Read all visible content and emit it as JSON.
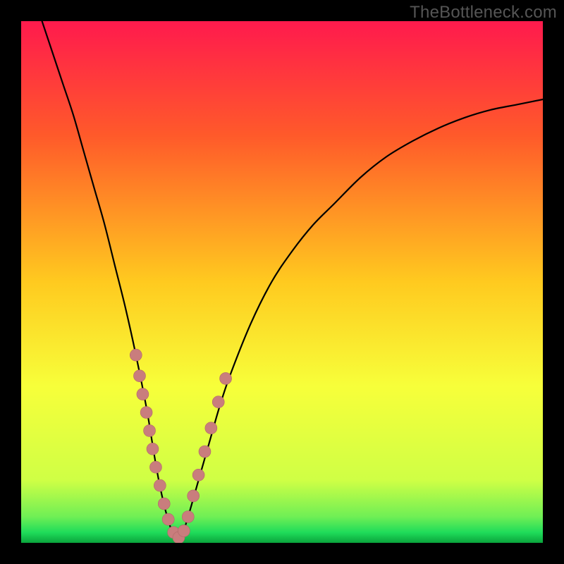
{
  "watermark": "TheBottleneck.com",
  "colors": {
    "frame": "#000000",
    "watermark": "#555555",
    "curve": "#000000",
    "marker_fill": "#c97d7d",
    "marker_stroke": "#b06868",
    "gradient_top": "#ff1a4d",
    "gradient_mid1": "#ff6a2a",
    "gradient_mid2": "#ffd21f",
    "gradient_mid3": "#f7ff3a",
    "gradient_low": "#d8ff4a",
    "gradient_green": "#1fdc5a",
    "gradient_base": "#0aa43c"
  },
  "chart_data": {
    "type": "line",
    "title": "",
    "xlabel": "",
    "ylabel": "",
    "xlim": [
      0,
      100
    ],
    "ylim": [
      0,
      100
    ],
    "series": [
      {
        "name": "bottleneck-curve",
        "x": [
          4,
          6,
          8,
          10,
          12,
          14,
          16,
          18,
          20,
          22,
          24,
          25,
          26,
          27,
          28,
          29,
          30,
          31,
          32,
          34,
          36,
          38,
          40,
          44,
          48,
          52,
          56,
          60,
          65,
          70,
          75,
          80,
          85,
          90,
          95,
          100
        ],
        "y": [
          100,
          94,
          88,
          82,
          75,
          68,
          61,
          53,
          45,
          36,
          26,
          20,
          14,
          9,
          5,
          2,
          0.6,
          2,
          5,
          12,
          19,
          26,
          32,
          42,
          50,
          56,
          61,
          65,
          70,
          74,
          77,
          79.5,
          81.5,
          83,
          84,
          85
        ]
      }
    ],
    "markers": {
      "name": "highlighted-points",
      "x": [
        22,
        22.7,
        23.3,
        24,
        24.6,
        25.2,
        25.8,
        26.6,
        27.4,
        28.2,
        29.2,
        30.2,
        31.2,
        32,
        33,
        34,
        35.2,
        36.4,
        37.8,
        39.2
      ],
      "y": [
        36,
        32,
        28.5,
        25,
        21.5,
        18,
        14.5,
        11,
        7.5,
        4.5,
        2,
        1,
        2.3,
        5,
        9,
        13,
        17.5,
        22,
        27,
        31.5
      ]
    },
    "gradient_stops": [
      {
        "offset": 0,
        "color": "#ff1a4d"
      },
      {
        "offset": 22,
        "color": "#ff5a2a"
      },
      {
        "offset": 50,
        "color": "#ffca1f"
      },
      {
        "offset": 70,
        "color": "#f7ff3a"
      },
      {
        "offset": 88,
        "color": "#cfff45"
      },
      {
        "offset": 95,
        "color": "#6fef55"
      },
      {
        "offset": 98,
        "color": "#1fdc5a"
      },
      {
        "offset": 100,
        "color": "#0aa43c"
      }
    ]
  }
}
